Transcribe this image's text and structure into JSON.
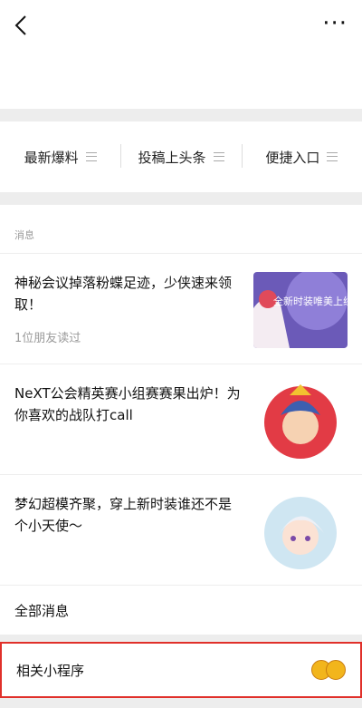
{
  "header": {
    "back_icon": "chevron-left-icon",
    "more_icon": "more-dots-icon",
    "more_glyph": "···"
  },
  "menu": {
    "items": [
      {
        "label": "最新爆料"
      },
      {
        "label": "投稿上头条"
      },
      {
        "label": "便捷入口"
      }
    ]
  },
  "messages": {
    "section_title": "消息",
    "articles": [
      {
        "title": "神秘会议掉落粉蝶足迹，少侠速来领取！",
        "meta": "1位朋友读过",
        "thumb_text": "全新时装唯美上线"
      },
      {
        "title": "NeXT公会精英赛小组赛赛果出炉！为你喜欢的战队打call",
        "meta": ""
      },
      {
        "title": "梦幻超模齐聚，穿上新时装谁还不是个小天使～",
        "meta": ""
      }
    ],
    "all_label": "全部消息"
  },
  "mini_program": {
    "label": "相关小程序",
    "highlight_color": "#e0302a"
  }
}
